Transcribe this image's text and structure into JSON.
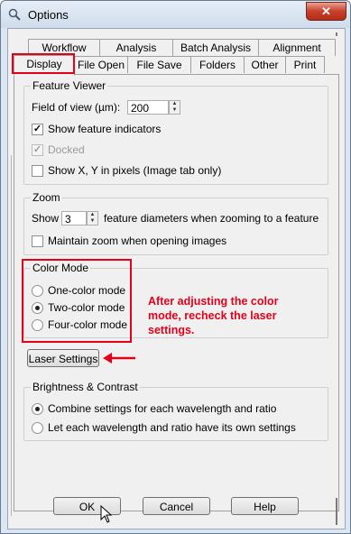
{
  "window": {
    "title": "Options",
    "close_symbol": "✕"
  },
  "tabs_top": [
    {
      "label": "Workflow"
    },
    {
      "label": "Analysis"
    },
    {
      "label": "Batch Analysis"
    },
    {
      "label": "Alignment"
    }
  ],
  "tabs_bottom": [
    {
      "label": "Display",
      "selected": true
    },
    {
      "label": "File Open"
    },
    {
      "label": "File Save"
    },
    {
      "label": "Folders"
    },
    {
      "label": "Other"
    },
    {
      "label": "Print"
    }
  ],
  "feature_viewer": {
    "title": "Feature Viewer",
    "fov_label": "Field of view (µm):",
    "fov_value": "200",
    "show_indicators": {
      "label": "Show feature indicators",
      "checked": true
    },
    "docked": {
      "label": "Docked",
      "checked": true,
      "disabled": true
    },
    "show_xy": {
      "label": "Show X, Y in pixels (Image tab only)",
      "checked": false
    }
  },
  "zoom": {
    "title": "Zoom",
    "show_label": "Show",
    "show_value": "3",
    "suffix": "feature diameters when zooming to a feature",
    "maintain": {
      "label": "Maintain zoom when opening images",
      "checked": false
    }
  },
  "color_mode": {
    "title": "Color Mode",
    "options": [
      {
        "label": "One-color mode",
        "selected": false
      },
      {
        "label": "Two-color mode",
        "selected": true
      },
      {
        "label": "Four-color mode",
        "selected": false
      }
    ]
  },
  "annotation": {
    "line1": "After adjusting the color",
    "line2": "mode, recheck the laser",
    "line3": "settings.",
    "color": "#e3001b"
  },
  "laser_button": "Laser Settings",
  "brightness": {
    "title": "Brightness & Contrast",
    "options": [
      {
        "label": "Combine settings for each wavelength and ratio",
        "selected": true
      },
      {
        "label": "Let each wavelength and ratio have its own settings",
        "selected": false
      }
    ]
  },
  "buttons": {
    "ok": "OK",
    "cancel": "Cancel",
    "help": "Help"
  }
}
